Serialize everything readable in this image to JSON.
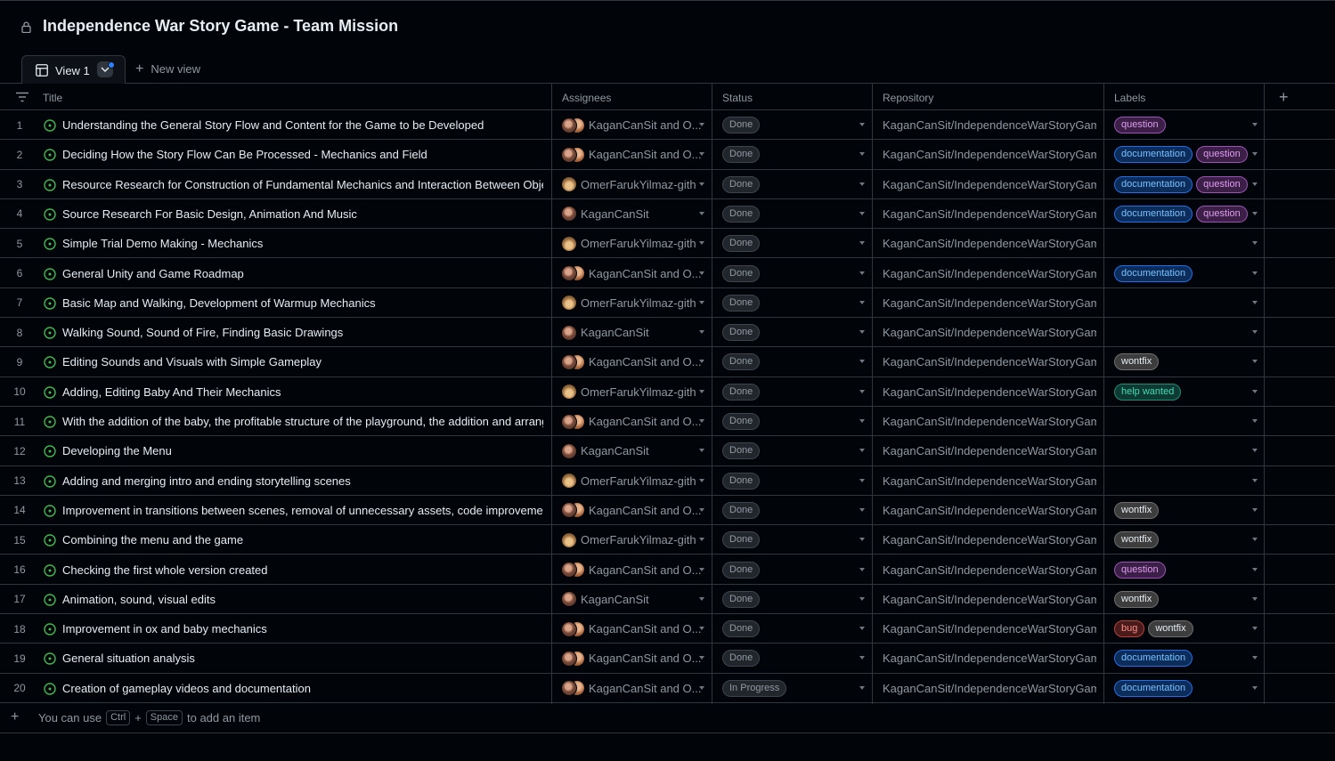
{
  "project": {
    "title": "Independence War Story Game - Team Mission"
  },
  "tabs": {
    "active_view": "View 1",
    "new_view": "New view"
  },
  "columns": {
    "title": "Title",
    "assignees": "Assignees",
    "status": "Status",
    "repository": "Repository",
    "labels": "Labels",
    "add": "+"
  },
  "rows": [
    {
      "n": "1",
      "title": "Understanding the General Story Flow and Content for the Game to be Developed",
      "assignees": "KaganCanSit and O...",
      "avatars": 2,
      "status": "Done",
      "repo": "KaganCanSit/IndependenceWarStoryGame",
      "labels": [
        "question"
      ]
    },
    {
      "n": "2",
      "title": "Deciding How the Story Flow Can Be Processed - Mechanics and Field",
      "assignees": "KaganCanSit and O...",
      "avatars": 2,
      "status": "Done",
      "repo": "KaganCanSit/IndependenceWarStoryGame",
      "labels": [
        "documentation",
        "question"
      ]
    },
    {
      "n": "3",
      "title": "Resource Research for Construction of Fundamental Mechanics and Interaction Between Objects",
      "assignees": "OmerFarukYilmaz-gith",
      "avatars": 1,
      "avatar_style": "b",
      "status": "Done",
      "repo": "KaganCanSit/IndependenceWarStoryGame",
      "labels": [
        "documentation",
        "question"
      ]
    },
    {
      "n": "4",
      "title": "Source Research For Basic Design, Animation And Music",
      "assignees": "KaganCanSit",
      "avatars": 1,
      "avatar_style": "a",
      "status": "Done",
      "repo": "KaganCanSit/IndependenceWarStoryGame",
      "labels": [
        "documentation",
        "question"
      ]
    },
    {
      "n": "5",
      "title": "Simple Trial Demo Making - Mechanics",
      "assignees": "OmerFarukYilmaz-gith",
      "avatars": 1,
      "avatar_style": "b",
      "status": "Done",
      "repo": "KaganCanSit/IndependenceWarStoryGame",
      "labels": []
    },
    {
      "n": "6",
      "title": "General Unity and Game Roadmap",
      "assignees": "KaganCanSit and O...",
      "avatars": 2,
      "status": "Done",
      "repo": "KaganCanSit/IndependenceWarStoryGame",
      "labels": [
        "documentation"
      ]
    },
    {
      "n": "7",
      "title": "Basic Map and Walking, Development of Warmup Mechanics",
      "assignees": "OmerFarukYilmaz-gith",
      "avatars": 1,
      "avatar_style": "b",
      "status": "Done",
      "repo": "KaganCanSit/IndependenceWarStoryGame",
      "labels": []
    },
    {
      "n": "8",
      "title": "Walking Sound, Sound of Fire, Finding Basic Drawings",
      "assignees": "KaganCanSit",
      "avatars": 1,
      "avatar_style": "a",
      "status": "Done",
      "repo": "KaganCanSit/IndependenceWarStoryGame",
      "labels": []
    },
    {
      "n": "9",
      "title": "Editing Sounds and Visuals with Simple Gameplay",
      "assignees": "KaganCanSit and O...",
      "avatars": 2,
      "status": "Done",
      "repo": "KaganCanSit/IndependenceWarStoryGame",
      "labels": [
        "wontfix"
      ]
    },
    {
      "n": "10",
      "title": "Adding, Editing Baby And Their Mechanics",
      "assignees": "OmerFarukYilmaz-gith",
      "avatars": 1,
      "avatar_style": "b",
      "status": "Done",
      "repo": "KaganCanSit/IndependenceWarStoryGame",
      "labels": [
        "help wanted"
      ]
    },
    {
      "n": "11",
      "title": "With the addition of the baby, the profitable structure of the playground, the addition and arrang",
      "assignees": "KaganCanSit and O...",
      "avatars": 2,
      "status": "Done",
      "repo": "KaganCanSit/IndependenceWarStoryGame",
      "labels": []
    },
    {
      "n": "12",
      "title": "Developing the Menu",
      "assignees": "KaganCanSit",
      "avatars": 1,
      "avatar_style": "a",
      "status": "Done",
      "repo": "KaganCanSit/IndependenceWarStoryGame",
      "labels": []
    },
    {
      "n": "13",
      "title": "Adding and merging intro and ending storytelling scenes",
      "assignees": "OmerFarukYilmaz-gith",
      "avatars": 1,
      "avatar_style": "b",
      "status": "Done",
      "repo": "KaganCanSit/IndependenceWarStoryGame",
      "labels": []
    },
    {
      "n": "14",
      "title": "Improvement in transitions between scenes, removal of unnecessary assets, code improvements",
      "assignees": "KaganCanSit and O...",
      "avatars": 2,
      "status": "Done",
      "repo": "KaganCanSit/IndependenceWarStoryGame",
      "labels": [
        "wontfix"
      ]
    },
    {
      "n": "15",
      "title": "Combining the menu and the game",
      "assignees": "OmerFarukYilmaz-gith",
      "avatars": 1,
      "avatar_style": "b",
      "status": "Done",
      "repo": "KaganCanSit/IndependenceWarStoryGame",
      "labels": [
        "wontfix"
      ]
    },
    {
      "n": "16",
      "title": "Checking the first whole version created",
      "assignees": "KaganCanSit and O...",
      "avatars": 2,
      "status": "Done",
      "repo": "KaganCanSit/IndependenceWarStoryGame",
      "labels": [
        "question"
      ]
    },
    {
      "n": "17",
      "title": "Animation, sound, visual edits",
      "assignees": "KaganCanSit",
      "avatars": 1,
      "avatar_style": "a",
      "status": "Done",
      "repo": "KaganCanSit/IndependenceWarStoryGame",
      "labels": [
        "wontfix"
      ]
    },
    {
      "n": "18",
      "title": "Improvement in ox and baby mechanics",
      "assignees": "KaganCanSit and O...",
      "avatars": 2,
      "status": "Done",
      "repo": "KaganCanSit/IndependenceWarStoryGame",
      "labels": [
        "bug",
        "wontfix"
      ]
    },
    {
      "n": "19",
      "title": "General situation analysis",
      "assignees": "KaganCanSit and O...",
      "avatars": 2,
      "status": "Done",
      "repo": "KaganCanSit/IndependenceWarStoryGame",
      "labels": [
        "documentation"
      ]
    },
    {
      "n": "20",
      "title": "Creation of gameplay videos and documentation",
      "assignees": "KaganCanSit and O...",
      "avatars": 2,
      "status": "In Progress",
      "repo": "KaganCanSit/IndependenceWarStoryGame",
      "labels": [
        "documentation"
      ]
    }
  ],
  "footer": {
    "hint_prefix": "You can use",
    "key1": "Ctrl",
    "plus": "+",
    "key2": "Space",
    "hint_suffix": "to add an item"
  },
  "colors": {
    "background": "#010409",
    "border": "#30363d",
    "open_issue": "#3fb950",
    "accent": "#2f81f7"
  },
  "icons": {
    "lock": "lock-icon",
    "table": "table-icon",
    "issue_open": "issue-opened-icon",
    "filter": "filter-icon"
  }
}
